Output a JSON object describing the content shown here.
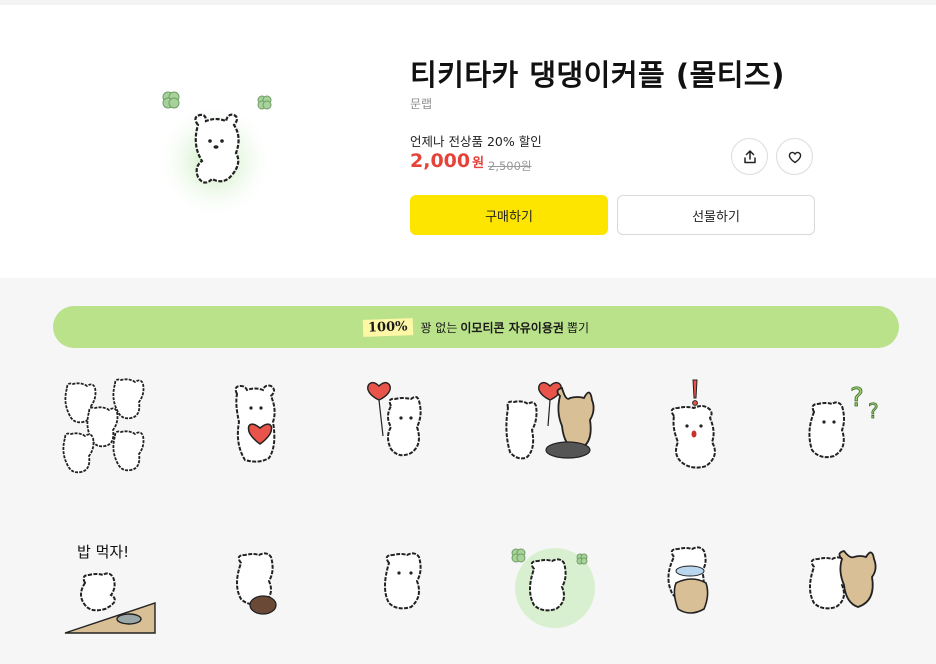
{
  "product": {
    "title": "티키타카 댕댕이커플 (몰티즈)",
    "brand": "문랩",
    "promo": "언제나 전상품 20% 할인",
    "price": "2,000",
    "price_unit": "원",
    "original_price": "2,500원",
    "buy_label": "구매하기",
    "gift_label": "선물하기",
    "share_icon": "share-icon",
    "like_icon": "heart-icon"
  },
  "banner": {
    "badge": "100%",
    "text_pre": "꽝 없는",
    "text_bold": "이모티콘 자유이용권",
    "text_post": "뽑기"
  },
  "emoticons": [
    {
      "caption": ""
    },
    {
      "caption": ""
    },
    {
      "caption": ""
    },
    {
      "caption": ""
    },
    {
      "caption": ""
    },
    {
      "caption": ""
    },
    {
      "caption": "밥 먹자!"
    },
    {
      "caption": ""
    },
    {
      "caption": ""
    },
    {
      "caption": ""
    },
    {
      "caption": ""
    },
    {
      "caption": ""
    }
  ],
  "colors": {
    "accent_yellow": "#fee500",
    "price_red": "#e5423a",
    "banner_green": "#b9e28a"
  }
}
